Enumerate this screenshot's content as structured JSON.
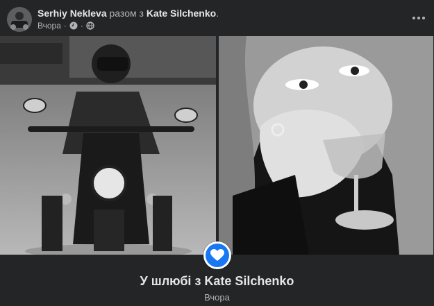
{
  "header": {
    "author": "Serhiy Nekleva",
    "with_text": "разом з",
    "tagged": "Kate Silchenko",
    "period": ".",
    "time": "Вчора",
    "separator": "·",
    "icons": [
      "messenger-rooms-icon",
      "globe-icon"
    ]
  },
  "photos": {
    "left_alt": "man on motorcycle",
    "right_alt": "woman with wine glass"
  },
  "life_event": {
    "title": "У шлюбі з Kate Silchenko",
    "date": "Вчора",
    "icon": "heart-icon",
    "badge_color": "#1877f2"
  }
}
